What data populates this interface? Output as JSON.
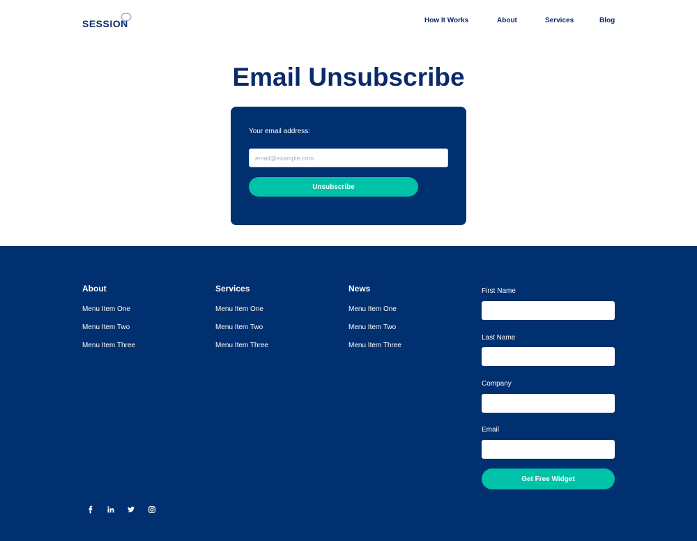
{
  "brand": {
    "name": "SESSION"
  },
  "nav": {
    "items": [
      {
        "label": "How It Works"
      },
      {
        "label": "About"
      },
      {
        "label": "Services"
      },
      {
        "label": "Blog"
      }
    ]
  },
  "hero": {
    "title": "Email Unsubscribe",
    "email_label": "Your email address:",
    "email_placeholder": "email@example.com",
    "email_value": "",
    "button_label": "Unsubscribe"
  },
  "footer": {
    "columns": [
      {
        "title": "About",
        "items": [
          "Menu Item One",
          "Menu Item Two",
          "Menu Item Three"
        ]
      },
      {
        "title": "Services",
        "items": [
          "Menu Item One",
          "Menu Item Two",
          "Menu Item Three"
        ]
      },
      {
        "title": "News",
        "items": [
          "Menu Item One",
          "Menu Item Two",
          "Menu Item Three"
        ]
      }
    ],
    "form": {
      "first_name_label": "First Name",
      "last_name_label": "Last Name",
      "company_label": "Company",
      "email_label": "Email",
      "button_label": "Get Free Widget"
    },
    "social": [
      {
        "icon": "facebook-icon"
      },
      {
        "icon": "linkedin-icon"
      },
      {
        "icon": "twitter-icon"
      },
      {
        "icon": "instagram-icon"
      }
    ]
  },
  "colors": {
    "brand_navy": "#0a2b6b",
    "footer_bg": "#00306f",
    "accent_teal": "#00c2a8"
  }
}
